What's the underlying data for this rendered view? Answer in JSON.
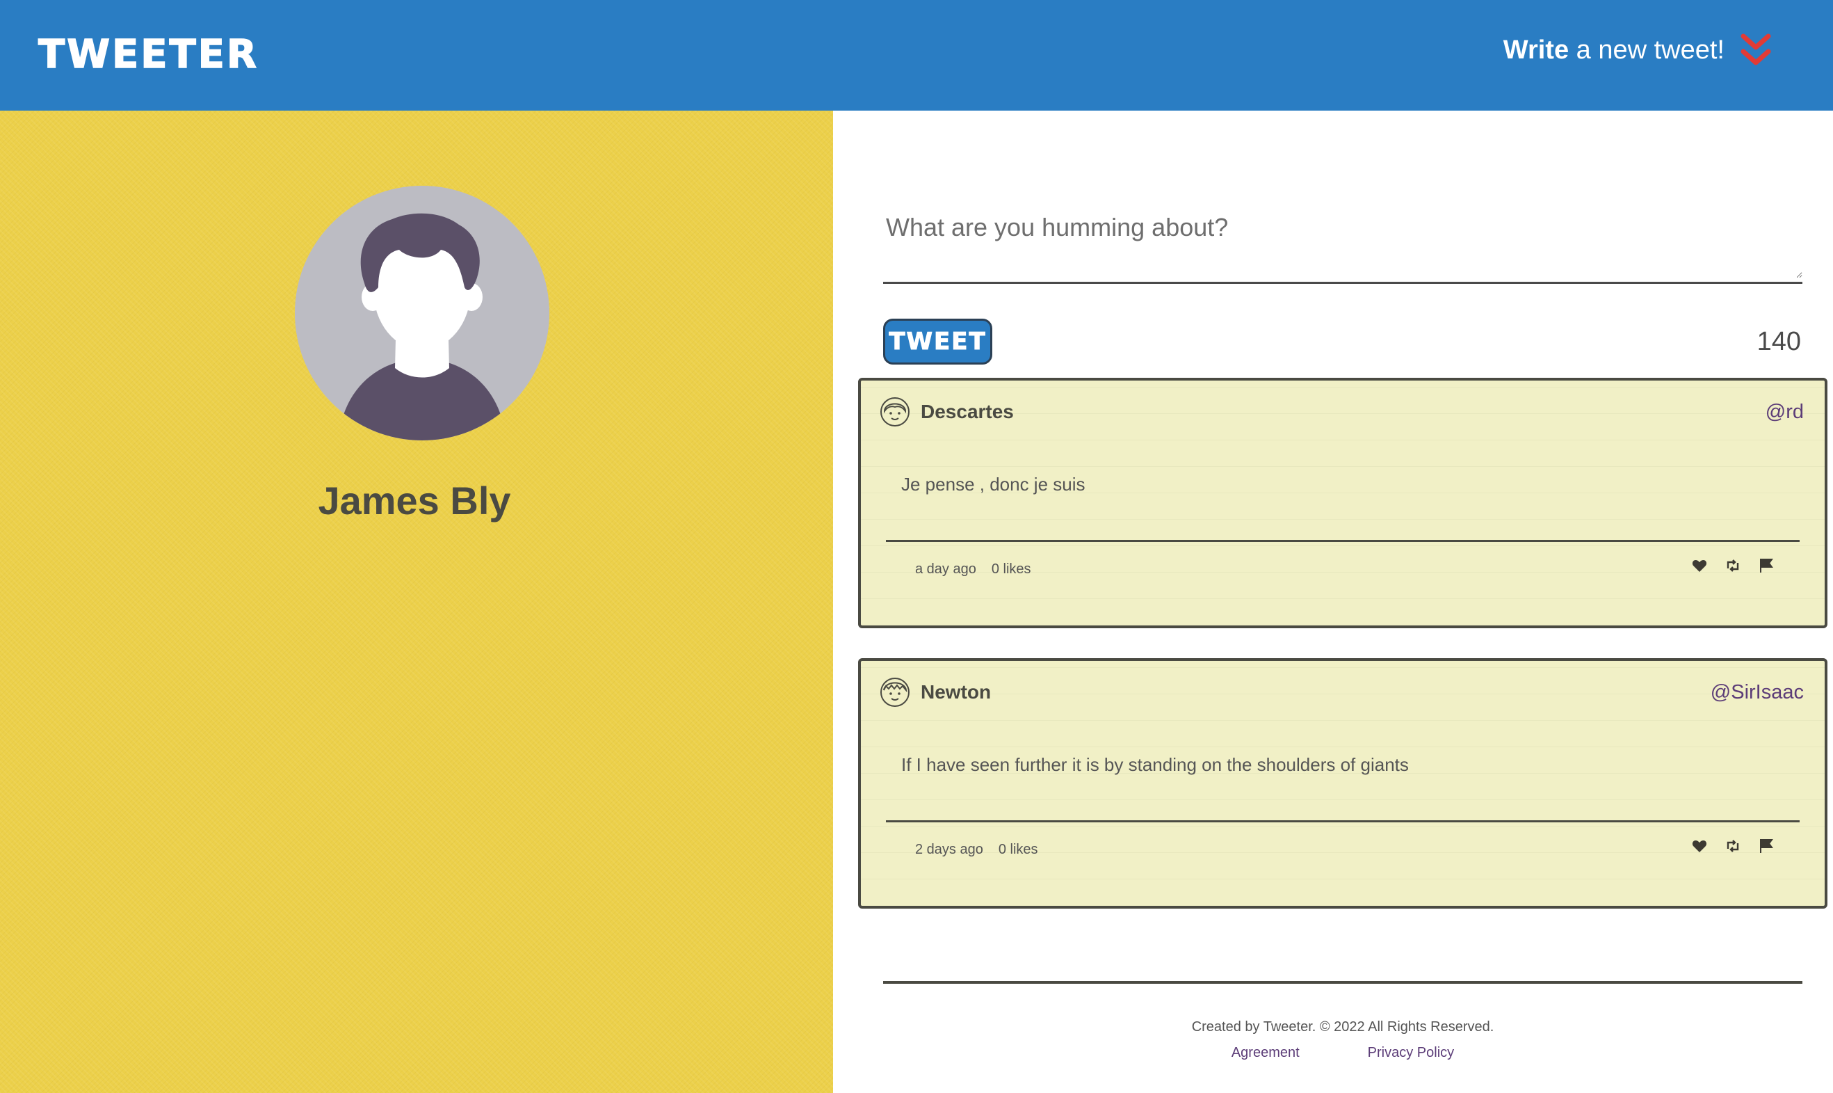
{
  "header": {
    "brand": "TWEETER",
    "compose_strong": "Write",
    "compose_rest": " a new tweet!",
    "chevron_icon": "double-chevron-down-icon",
    "colors": {
      "bar": "#2a7dc3",
      "chevron": "#e23b36"
    }
  },
  "profile": {
    "name": "James Bly",
    "avatar_icon": "user-avatar-illustration",
    "background_color": "#ecd04a"
  },
  "composer": {
    "placeholder": "What are you humming about?",
    "submit_label": "TWEET",
    "char_counter": "140"
  },
  "tweets": [
    {
      "avatar_icon": "user-face-icon",
      "name": "Descartes",
      "handle": "@rd",
      "body": "Je pense , donc je suis",
      "time": "a day ago",
      "likes": "0 likes"
    },
    {
      "avatar_icon": "user-face-icon",
      "name": "Newton",
      "handle": "@SirIsaac",
      "body": "If I have seen further it is by standing on the shoulders of giants",
      "time": "2 days ago",
      "likes": "0 likes"
    }
  ],
  "tweet_actions": [
    "heart-icon",
    "retweet-icon",
    "flag-icon"
  ],
  "footer": {
    "note": "Created by Tweeter. © 2022 All Rights Reserved.",
    "links": [
      "Agreement",
      "Privacy Policy"
    ]
  }
}
